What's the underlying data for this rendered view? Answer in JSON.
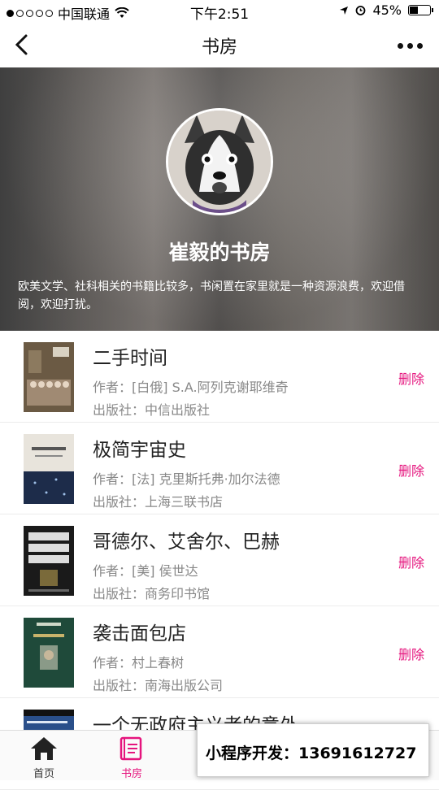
{
  "status_bar": {
    "carrier": "中国联通",
    "time": "下午2:51",
    "battery": "45%",
    "battery_level": 0.45
  },
  "nav": {
    "title": "书房"
  },
  "profile": {
    "name": "崔毅的书房",
    "description": "欧美文学、社科相关的书籍比较多，书闲置在家里就是一种资源浪费，欢迎借阅，欢迎打扰。"
  },
  "books": [
    {
      "title": "二手时间",
      "author": "作者：[白俄] S.A.阿列克谢耶维奇",
      "publisher": "出版社：中信出版社",
      "action": "删除"
    },
    {
      "title": "极简宇宙史",
      "author": "作者：[法] 克里斯托弗·加尔法德",
      "publisher": "出版社：上海三联书店",
      "action": "删除"
    },
    {
      "title": "哥德尔、艾舍尔、巴赫",
      "author": "作者：[美] 侯世达",
      "publisher": "出版社：商务印书馆",
      "action": "删除"
    },
    {
      "title": "袭击面包店",
      "author": "作者：村上春树",
      "publisher": "出版社：南海出版公司",
      "action": "删除"
    },
    {
      "title": "一个无政府主义者的意外"
    }
  ],
  "tabbar": {
    "tabs": [
      {
        "label": "首页",
        "icon": "home-icon",
        "active": false
      },
      {
        "label": "书房",
        "icon": "book-icon",
        "active": true
      }
    ]
  },
  "promo": {
    "text": "小程序开发：13691612727"
  },
  "colors": {
    "accent": "#e5147d",
    "text": "#222222",
    "muted": "#888888"
  }
}
